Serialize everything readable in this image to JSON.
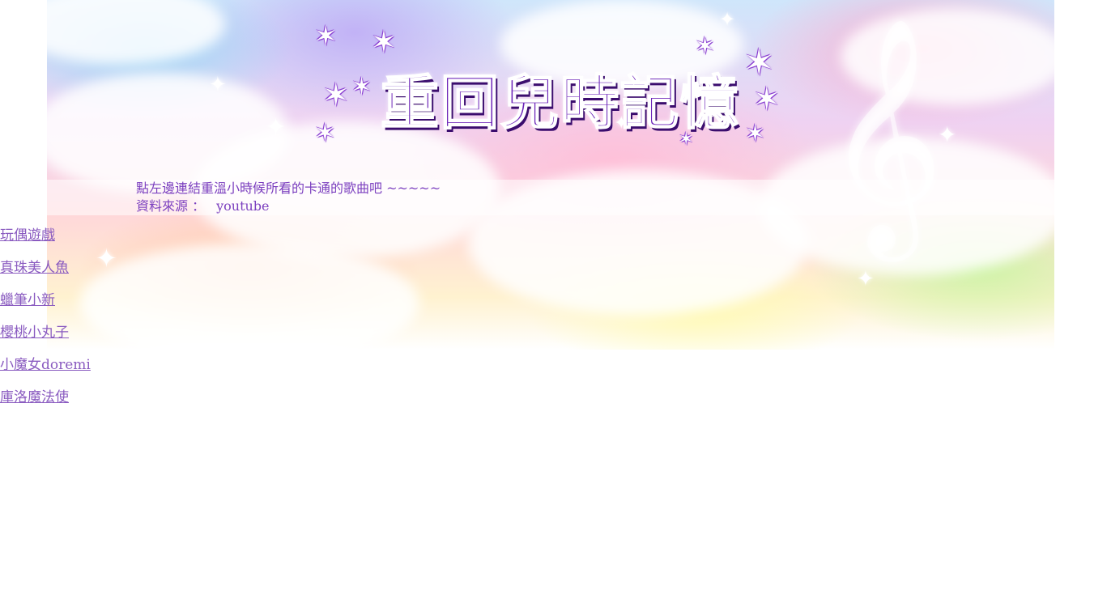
{
  "header": {
    "title": "重回兒時記憶"
  },
  "info": {
    "line1": "點左邊連結重溫小時候所看的卡通的歌曲吧 ~~~~~",
    "source_label": "資料來源 ：",
    "source_value": "youtube"
  },
  "nav": {
    "links": [
      {
        "label": "玩偶遊戲"
      },
      {
        "label": "真珠美人魚"
      },
      {
        "label": "蠟筆小新"
      },
      {
        "label": "櫻桃小丸子"
      },
      {
        "label": "小魔女doremi"
      },
      {
        "label": "庫洛魔法使"
      }
    ]
  },
  "colors": {
    "title": "#6b22b8",
    "text": "#7b3fbf",
    "link": "#8a5bc0"
  },
  "icons": {
    "decor_left": "star-cluster-icon",
    "decor_right": "star-cluster-icon",
    "clef": "treble-clef-icon"
  }
}
